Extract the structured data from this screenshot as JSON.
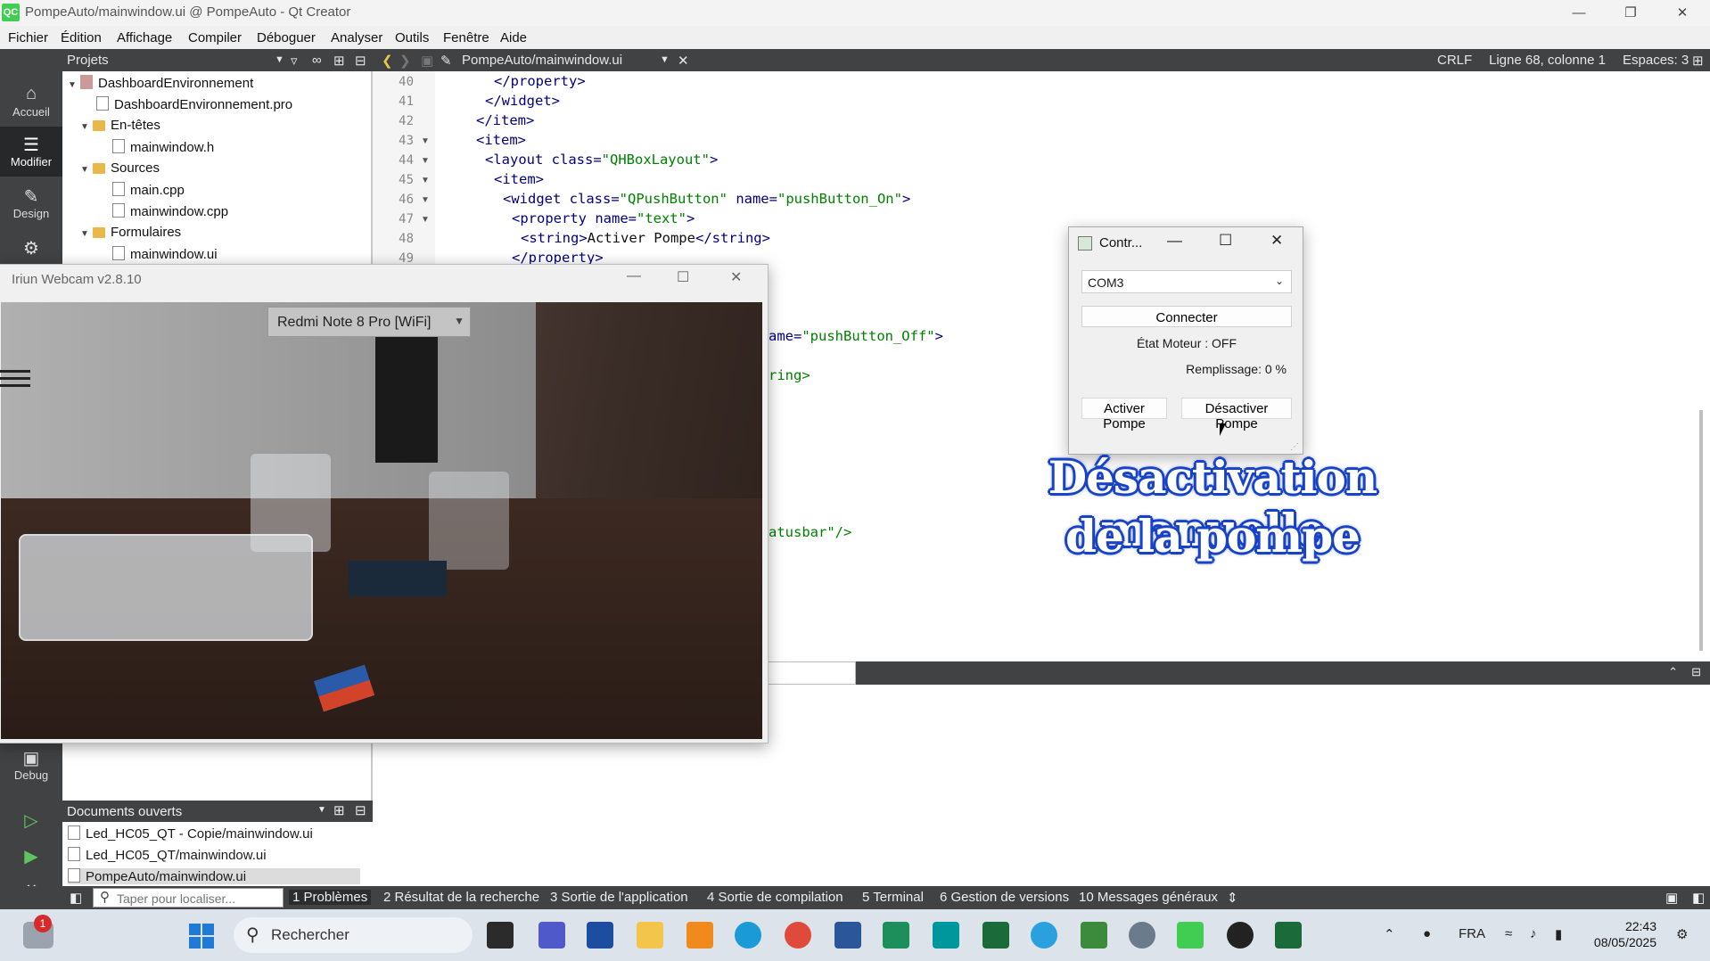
{
  "app": {
    "title": "PompeAuto/mainwindow.ui @ PompeAuto - Qt Creator",
    "icon_label": "QC"
  },
  "menu": [
    "Fichier",
    "Édition",
    "Affichage",
    "Compiler",
    "Déboguer",
    "Analyser",
    "Outils",
    "Fenêtre",
    "Aide"
  ],
  "toolbar": {
    "projects_label": "Projets",
    "open_file": "PompeAuto/mainwindow.ui",
    "line_ending": "CRLF",
    "cursor_pos": "Ligne 68, colonne 1",
    "indent": "Espaces: 3"
  },
  "modes": [
    {
      "label": "Accueil",
      "icon": "home-icon"
    },
    {
      "label": "Modifier",
      "icon": "edit-icon"
    },
    {
      "label": "Design",
      "icon": "design-icon"
    },
    {
      "label": "Debug",
      "icon": "debug-icon"
    }
  ],
  "tree": {
    "root": "DashboardEnvironnement",
    "pro": "DashboardEnvironnement.pro",
    "headers": "En-têtes",
    "header_file": "mainwindow.h",
    "sources": "Sources",
    "src1": "main.cpp",
    "src2": "mainwindow.cpp",
    "forms": "Formulaires",
    "form_file": "mainwindow.ui"
  },
  "code": {
    "lines": [
      "40",
      "41",
      "42",
      "43",
      "44",
      "45",
      "46",
      "47",
      "48",
      "49"
    ],
    "l40": "</property>",
    "l41": "</widget>",
    "l42": "</item>",
    "l43": "<item>",
    "l44a": "<layout class=",
    "l44b": "\"QHBoxLayout\"",
    "l44c": ">",
    "l45": "<item>",
    "l46a": "<widget class=",
    "l46b": "\"QPushButton\"",
    "l46c": " name=",
    "l46d": "\"pushButton_On\"",
    "l46e": ">",
    "l47a": "<property name=",
    "l47b": "\"text\"",
    "l47c": ">",
    "l48a": "<string>",
    "l48b": "Activer Pompe",
    "l48c": "</string>",
    "l49": "</property>",
    "frag1a": "ame=",
    "frag1b": "\"pushButton_Off\"",
    "frag1c": ">",
    "frag2": "ring>",
    "frag3": "atusbar\"/>"
  },
  "docs": {
    "title": "Documents ouverts",
    "items": [
      "Led_HC05_QT - Copie/mainwindow.ui",
      "Led_HC05_QT/mainwindow.ui",
      "PompeAuto/mainwindow.ui"
    ]
  },
  "status": {
    "locate_placeholder": "Taper pour localiser...",
    "panes": [
      "1 Problèmes",
      "2 Résultat de la recherche",
      "3 Sortie de l'application",
      "4 Sortie de compilation",
      "5 Terminal",
      "6 Gestion de versions",
      "10 Messages généraux"
    ]
  },
  "webcam": {
    "title": "Iriun Webcam v2.8.10",
    "device": "Redmi Note 8 Pro [WiFi]"
  },
  "control": {
    "title": "Contr...",
    "port": "COM3",
    "connect": "Connecter",
    "motor_state": "État Moteur : OFF",
    "fill": "Remplissage: 0 %",
    "activate": "Activer Pompe",
    "deactivate": "Désactiver Pompe"
  },
  "caption": {
    "line1": "Désactivation manuelle",
    "line2": "de la pompe"
  },
  "taskbar": {
    "search": "Rechercher",
    "lang": "FRA",
    "time": "22:43",
    "date": "08/05/2025",
    "notif_count": "1"
  }
}
